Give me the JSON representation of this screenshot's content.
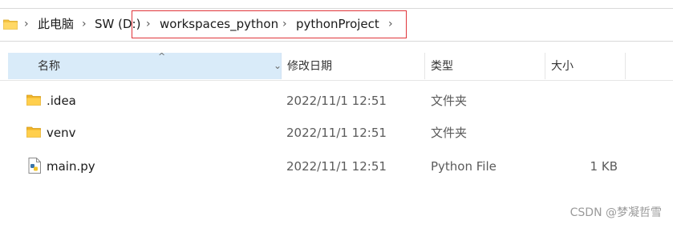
{
  "breadcrumb": {
    "items": [
      "此电脑",
      "SW (D:)",
      "workspaces_python",
      "pythonProject"
    ]
  },
  "columns": {
    "name": "名称",
    "date": "修改日期",
    "type": "类型",
    "size": "大小"
  },
  "files": [
    {
      "name": ".idea",
      "date": "2022/11/1 12:51",
      "type": "文件夹",
      "size": "",
      "icon": "folder-icon"
    },
    {
      "name": "venv",
      "date": "2022/11/1 12:51",
      "type": "文件夹",
      "size": "",
      "icon": "folder-icon"
    },
    {
      "name": "main.py",
      "date": "2022/11/1 12:51",
      "type": "Python File",
      "size": "1 KB",
      "icon": "python-file-icon"
    }
  ],
  "watermark": "CSDN @梦凝哲雪",
  "colors": {
    "header_selected": "#d9ebf9",
    "annotation_box": "#e0353a",
    "folder": "#f5c342"
  }
}
